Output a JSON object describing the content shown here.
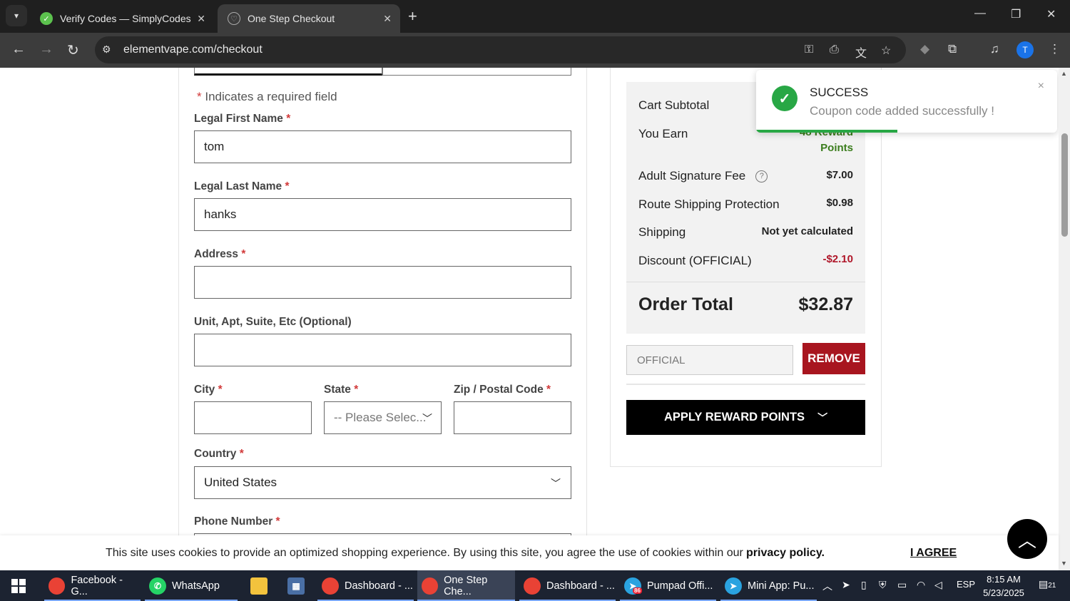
{
  "browser": {
    "tabs": [
      {
        "title": "Verify Codes — SimplyCodes",
        "active": false
      },
      {
        "title": "One Step Checkout",
        "active": true
      }
    ],
    "url": "elementvape.com/checkout",
    "profile_initial": "T"
  },
  "form": {
    "required_note_star": "*",
    "required_note": "Indicates a required field",
    "first_name": {
      "label": "Legal First Name",
      "value": "tom"
    },
    "last_name": {
      "label": "Legal Last Name",
      "value": "hanks"
    },
    "address": {
      "label": "Address",
      "value": ""
    },
    "unit": {
      "label": "Unit, Apt, Suite, Etc (Optional)",
      "value": ""
    },
    "city": {
      "label": "City",
      "value": ""
    },
    "state": {
      "label": "State",
      "value": "-- Please Selec..."
    },
    "zip": {
      "label": "Zip / Postal Code",
      "value": ""
    },
    "country": {
      "label": "Country",
      "value": "United States"
    },
    "phone": {
      "label": "Phone Number"
    },
    "star": "*"
  },
  "summary": {
    "cart_subtotal_label": "Cart Subtotal",
    "you_earn_label": "You Earn",
    "you_earn_value_line1": "48 Reward",
    "you_earn_value_line2": "Points",
    "adult_fee_label": "Adult Signature Fee",
    "adult_fee_value": "$7.00",
    "route_label": "Route Shipping Protection",
    "route_value": "$0.98",
    "shipping_label": "Shipping",
    "shipping_value": "Not yet calculated",
    "discount_label": "Discount (OFFICIAL)",
    "discount_value": "-$2.10",
    "order_total_label": "Order Total",
    "order_total_value": "$32.87",
    "coupon_placeholder": "OFFICIAL",
    "remove_label": "REMOVE",
    "apply_reward_label": "APPLY REWARD POINTS"
  },
  "toast": {
    "title": "SUCCESS",
    "message": "Coupon code added successfully !",
    "progress": 0.47
  },
  "cookie": {
    "text": "This site uses cookies to provide an optimized shopping experience. By using this site, you agree the use of cookies within our",
    "link": "privacy policy.",
    "agree": "I AGREE"
  },
  "taskbar": {
    "items": [
      {
        "label": "Facebook - G...",
        "icon": "chrome-icon"
      },
      {
        "label": "WhatsApp",
        "icon": "whatsapp-icon"
      },
      {
        "label": "",
        "icon": "file-explorer-icon"
      },
      {
        "label": "",
        "icon": "calculator-icon"
      },
      {
        "label": "Dashboard - ...",
        "icon": "chrome-icon"
      },
      {
        "label": "One Step Che...",
        "icon": "chrome-icon"
      },
      {
        "label": "Dashboard - ...",
        "icon": "chrome-icon"
      },
      {
        "label": "Pumpad Offi...",
        "icon": "telegram-icon"
      },
      {
        "label": "Mini App: Pu...",
        "icon": "telegram-icon"
      }
    ],
    "language": "ESP",
    "time": "8:15 AM",
    "date": "5/23/2025",
    "notification_count": "21",
    "telegram_badge": "86"
  },
  "colors": {
    "accent_red": "#a8151f",
    "success_green": "#28a745",
    "reward_green": "#3b7d1d"
  }
}
